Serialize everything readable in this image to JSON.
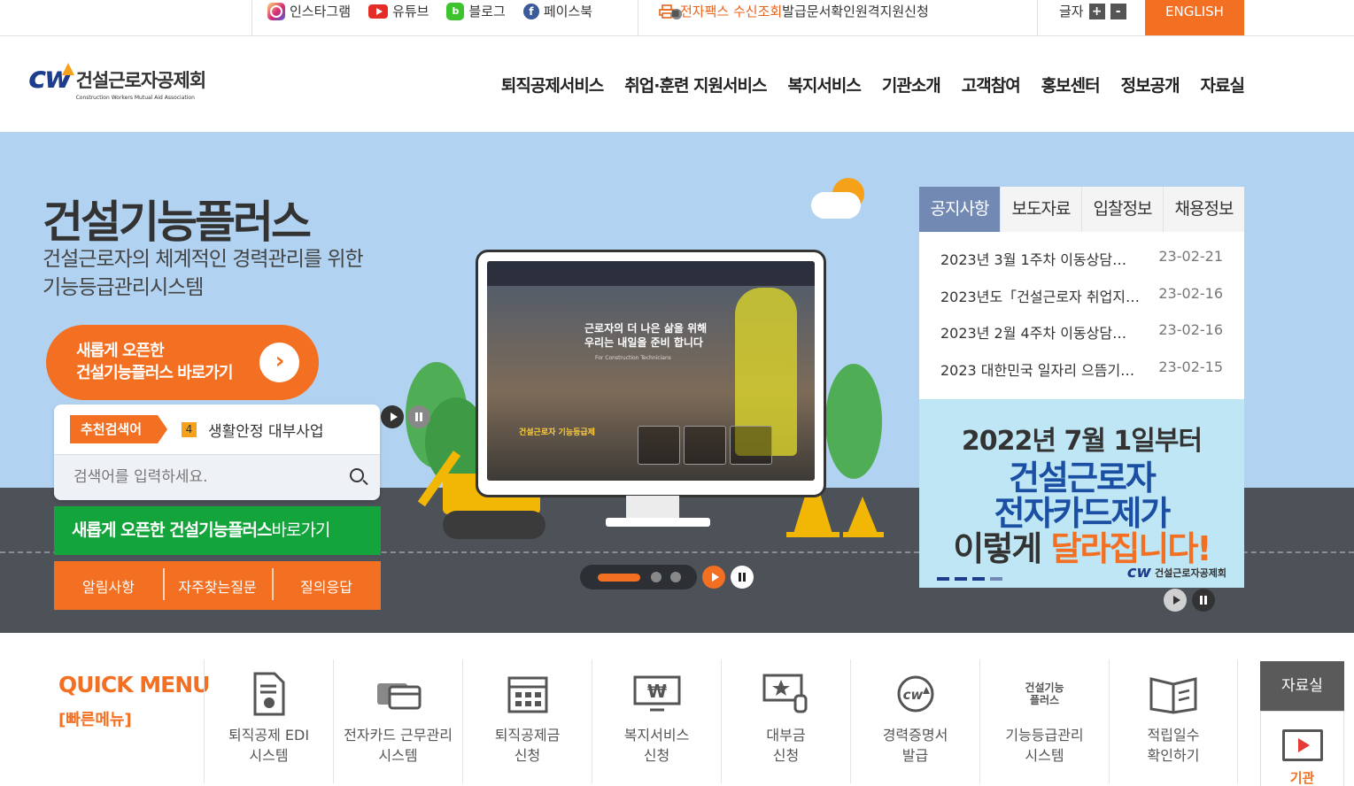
{
  "topbar": {
    "sns": [
      {
        "label": "인스타그램",
        "icon": "instagram-icon"
      },
      {
        "label": "유튜브",
        "icon": "youtube-icon"
      },
      {
        "label": "블로그",
        "icon": "blog-icon"
      },
      {
        "label": "페이스북",
        "icon": "facebook-icon"
      }
    ],
    "fax": "전자팩스 수신조회",
    "doc_check": "발급문서확인",
    "remote": "원격지원신청",
    "font_label": "글자",
    "font_plus": "+",
    "font_minus": "-",
    "english": "ENGLISH"
  },
  "header": {
    "logo_mark": "cw",
    "logo_kr": "건설근로자공제회",
    "logo_en": "Construction Workers Mutual Aid Association",
    "nav": [
      "퇴직공제서비스",
      "취업·훈련 지원서비스",
      "복지서비스",
      "기관소개",
      "고객참여",
      "홍보센터",
      "정보공개",
      "자료실"
    ]
  },
  "hero": {
    "title": "건설기능플러스",
    "subtitle_1": "건설근로자의 체계적인 경력관리를 위한",
    "subtitle_2": "기능등급관리시스템",
    "cta_1": "새롭게 오픈한",
    "cta_2": "건설기능플러스 바로가기",
    "cta_arrow": "›",
    "screen_line1": "근로자의 더 나은 삶을 위해",
    "screen_line2": "우리는 내일을 준비 합니다",
    "screen_en": "For Construction Technicians",
    "screen_band": "건설근로자 기능등급제"
  },
  "search": {
    "rec_label": "추천검색어",
    "rec_num": "4",
    "rec_word": "생활안정 대부사업",
    "placeholder": "검색어를 입력하세요."
  },
  "green_btn": {
    "bold": "새롭게 오픈한 건설기능플러스",
    "normal": "바로가기"
  },
  "orange_tabs": [
    "알림사항",
    "자주찾는질문",
    "질의응답"
  ],
  "board": {
    "tabs": [
      "공지사항",
      "보도자료",
      "입찰정보",
      "채용정보"
    ],
    "rows": [
      {
        "title": "2023년 3월 1주차 이동상담…",
        "date": "23-02-21"
      },
      {
        "title": "2023년도「건설근로자 취업지…",
        "date": "23-02-16"
      },
      {
        "title": "2023년 2월 4주차 이동상담…",
        "date": "23-02-16"
      },
      {
        "title": "2023 대한민국 일자리 으뜸기…",
        "date": "23-02-15"
      }
    ]
  },
  "banner": {
    "line1": "2022년 7월 1일부터",
    "line2": "건설근로자",
    "line3": "전자카드제가",
    "line4a": "이렇게 ",
    "line4b": "달라집니다!",
    "logo_mark": "cw",
    "logo_kr": "건설근로자공제회"
  },
  "quick": {
    "title": "QUICK MENU",
    "subtitle": "[빠른메뉴]",
    "items": [
      {
        "l1": "퇴직공제 EDI",
        "l2": "시스템"
      },
      {
        "l1": "전자카드 근무관리",
        "l2": "시스템"
      },
      {
        "l1": "퇴직공제금",
        "l2": "신청"
      },
      {
        "l1": "복지서비스",
        "l2": "신청"
      },
      {
        "l1": "대부금",
        "l2": "신청"
      },
      {
        "l1": "경력증명서",
        "l2": "발급"
      },
      {
        "l1": "기능등급관리",
        "l2": "시스템"
      },
      {
        "l1": "적립일수",
        "l2": "확인하기"
      }
    ],
    "icon_text_6": "건설기능",
    "icon_text_6b": "플러스",
    "side_tab": "자료실",
    "side_label": "기관"
  },
  "colors": {
    "accent": "#f36f21",
    "brand": "#1d3c8c",
    "green": "#14a43c",
    "tab_active": "#7289b3"
  }
}
